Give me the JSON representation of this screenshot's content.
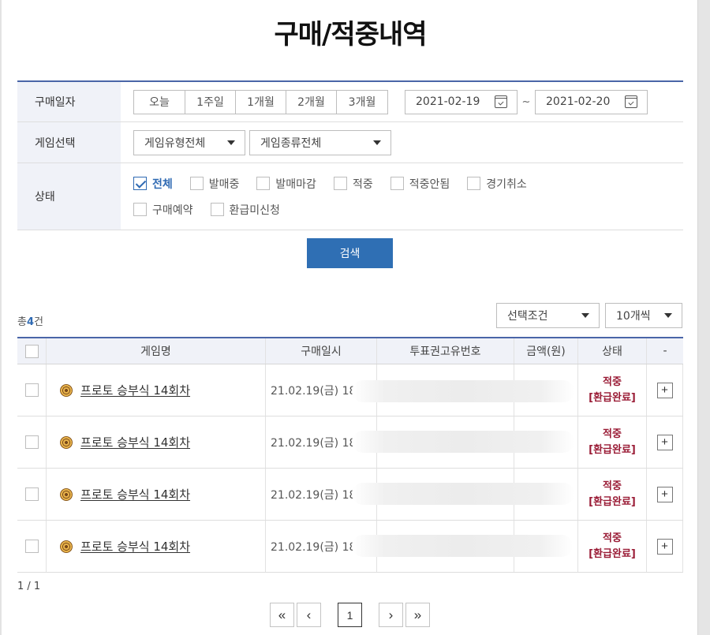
{
  "page_title": "구매/적중내역",
  "filter": {
    "date_label": "구매일자",
    "periods": [
      "오늘",
      "1주일",
      "1개월",
      "2개월",
      "3개월"
    ],
    "start_date": "2021-02-19",
    "date_separator": "~",
    "end_date": "2021-02-20",
    "game_label": "게임선택",
    "game_type": "게임유형전체",
    "game_kind": "게임종류전체",
    "status_label": "상태",
    "status_options": [
      {
        "label": "전체",
        "checked": true
      },
      {
        "label": "발매중",
        "checked": false
      },
      {
        "label": "발매마감",
        "checked": false
      },
      {
        "label": "적중",
        "checked": false
      },
      {
        "label": "적중안됨",
        "checked": false
      },
      {
        "label": "경기취소",
        "checked": false
      },
      {
        "label": "구매예약",
        "checked": false
      },
      {
        "label": "환급미신청",
        "checked": false
      }
    ]
  },
  "search_button": "검색",
  "summary": {
    "prefix": "총",
    "count": "4",
    "suffix": "건"
  },
  "condition_select": "선택조건",
  "count_select": "10개씩",
  "table": {
    "headers": [
      "게임명",
      "구매일시",
      "투표권고유번호",
      "금액(원)",
      "상태",
      "-"
    ],
    "rows": [
      {
        "game": "프로토 승부식 14회차",
        "datetime": "21.02.19(금) 18",
        "status1": "적중",
        "status2": "[환급완료]",
        "expand": "+"
      },
      {
        "game": "프로토 승부식 14회차",
        "datetime": "21.02.19(금) 18:",
        "status1": "적중",
        "status2": "[환급완료]",
        "expand": "+"
      },
      {
        "game": "프로토 승부식 14회차",
        "datetime": "21.02.19(금) 18:",
        "status1": "적중",
        "status2": "[환급완료]",
        "expand": "+"
      },
      {
        "game": "프로토 승부식 14회차",
        "datetime": "21.02.19(금) 18:",
        "status1": "적중",
        "status2": "[환급완료]",
        "expand": "+"
      }
    ]
  },
  "page_info": "1 / 1",
  "pagination": {
    "first": "«",
    "prev": "‹",
    "current": "1",
    "next": "›",
    "last": "»"
  },
  "colors": {
    "accent": "#2f6fb4",
    "status": "#9a1c36",
    "header_bg": "#f0f2f8"
  }
}
